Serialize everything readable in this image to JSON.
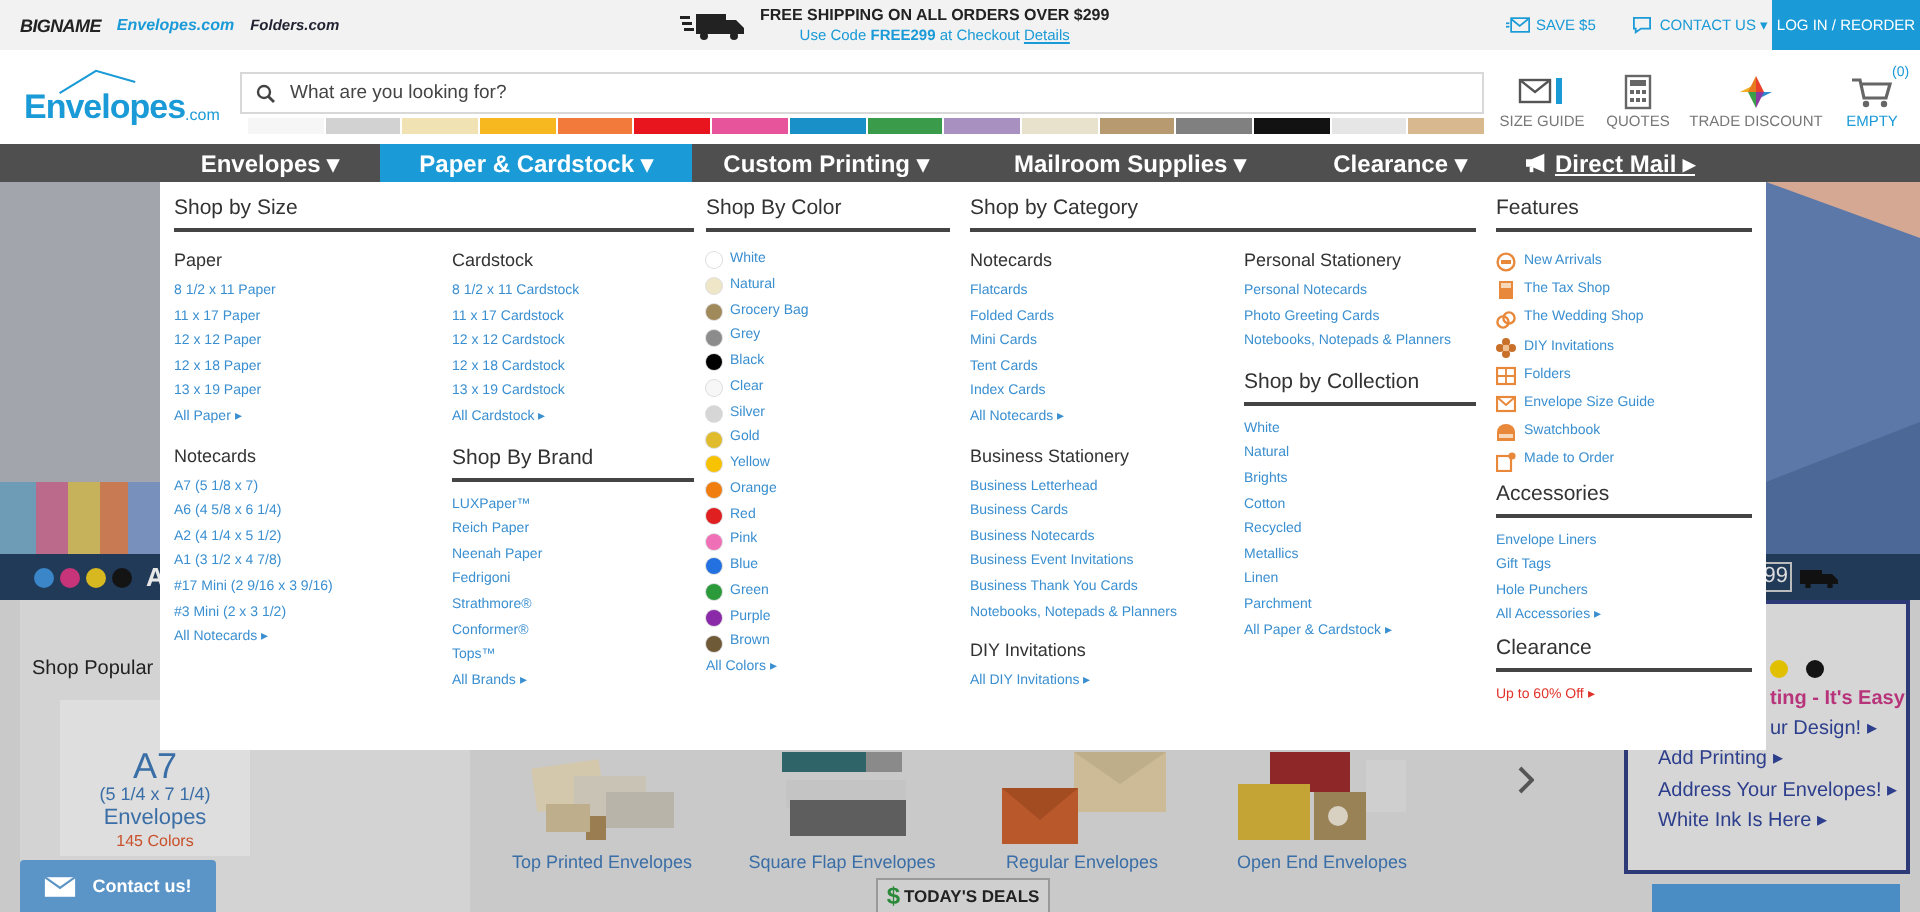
{
  "top_bar": {
    "logos": [
      {
        "text": "BIGNAME",
        "kind": "bigname"
      },
      {
        "text": "Envelopes.com",
        "kind": "envelopes"
      },
      {
        "text": "Folders.com",
        "kind": "folders"
      }
    ],
    "shipping": "FREE SHIPPING ON ALL ORDERS OVER $299",
    "code_line": "Use Code **FREE299** at Checkout",
    "details_link": "Details",
    "save": "SAVE $5",
    "contact": "CONTACT US ▾",
    "login": "LOG IN / REORDER"
  },
  "header": {
    "logo": {
      "name": "Envelopes",
      "suffix": ".com"
    },
    "search_placeholder": "What are you looking for?",
    "swatches": [
      {
        "color": "#f6f6f6"
      },
      {
        "color": "#d2d2d2"
      },
      {
        "color": "#f1e2b4"
      },
      {
        "color": "#f6b81e"
      },
      {
        "color": "#f27a3a"
      },
      {
        "color": "#e8141e"
      },
      {
        "color": "#e8549c"
      },
      {
        "color": "#1a90c8"
      },
      {
        "color": "#3a9c4a"
      },
      {
        "color": "#a890c0"
      },
      {
        "color": "#e8e2cc"
      },
      {
        "color": "#b89a70"
      },
      {
        "color": "#808080"
      },
      {
        "color": "#121212"
      },
      {
        "color": "#e6e6e6"
      },
      {
        "color": "#d8b88e"
      }
    ],
    "tools": [
      {
        "kind": "size_guide",
        "label": "SIZE GUIDE"
      },
      {
        "kind": "quotes",
        "label": "QUOTES"
      },
      {
        "kind": "trade",
        "label": "TRADE DISCOUNT"
      },
      {
        "kind": "cart",
        "label": "EMPTY",
        "count": "(0)"
      }
    ]
  },
  "nav": [
    {
      "label": "Envelopes ▾",
      "selected": false,
      "kind": "menu"
    },
    {
      "label": "Paper & Cardstock ▾",
      "selected": true,
      "kind": "menu"
    },
    {
      "label": "Custom Printing ▾",
      "selected": false,
      "kind": "menu"
    },
    {
      "label": "Mailroom Supplies ▾",
      "selected": false,
      "kind": "menu"
    },
    {
      "label": "Clearance ▾",
      "selected": false,
      "kind": "menu"
    },
    {
      "label": "Direct Mail ▸",
      "selected": false,
      "kind": "promo"
    }
  ],
  "mega_menu": {
    "by_size": {
      "title": "Shop by Size",
      "columns": [
        [
          {
            "title": "Paper",
            "links": [
              "8 1/2 x 11 Paper",
              "11 x 17 Paper",
              "12 x 12 Paper",
              "12 x 18 Paper",
              "13 x 19 Paper",
              "All Paper ▸"
            ]
          },
          {
            "title": "Notecards",
            "links": [
              "A7 (5 1/8 x 7)",
              "A6 (4 5/8 x 6 1/4)",
              "A2 (4 1/4 x 5 1/2)",
              "A1 (3 1/2 x 4 7/8)",
              "#17 Mini (2 9/16 x 3 9/16)",
              "#3 Mini (2 x 3 1/2)",
              "All Notecards ▸"
            ]
          }
        ],
        [
          {
            "title": "Cardstock",
            "links": [
              "8 1/2 x 11 Cardstock",
              "11 x 17 Cardstock",
              "12 x 12 Cardstock",
              "12 x 18 Cardstock",
              "13 x 19 Cardstock",
              "All Cardstock ▸"
            ]
          }
        ]
      ]
    },
    "by_brand": {
      "title": "Shop By Brand",
      "links": [
        "LUXPaper™",
        "Reich Paper",
        "Neenah Paper",
        "Fedrigoni",
        "Strathmore®",
        "Conformer®",
        "Tops™",
        "All Brands ▸"
      ]
    },
    "by_color": {
      "title": "Shop By Color",
      "items": [
        {
          "label": "White",
          "color": "#ffffff"
        },
        {
          "label": "Natural",
          "color": "#efe6c8"
        },
        {
          "label": "Grocery Bag",
          "color": "#a08a5c"
        },
        {
          "label": "Grey",
          "color": "#8c8c8c"
        },
        {
          "label": "Black",
          "color": "#000000"
        },
        {
          "label": "Clear",
          "color": "#f7f7f7"
        },
        {
          "label": "Silver",
          "color": "#d6d6d6"
        },
        {
          "label": "Gold",
          "color": "#e0bc2c"
        },
        {
          "label": "Yellow",
          "color": "#f7c200"
        },
        {
          "label": "Orange",
          "color": "#ef7d10"
        },
        {
          "label": "Red",
          "color": "#e02020"
        },
        {
          "label": "Pink",
          "color": "#f070b8"
        },
        {
          "label": "Blue",
          "color": "#2370e0"
        },
        {
          "label": "Green",
          "color": "#2a9a3a"
        },
        {
          "label": "Purple",
          "color": "#8a2aa8"
        },
        {
          "label": "Brown",
          "color": "#6f5a38"
        }
      ],
      "more": "All Colors ▸"
    },
    "by_category": {
      "title": "Shop by Category",
      "columns": [
        [
          {
            "title": "Notecards",
            "links": [
              "Flatcards",
              "Folded Cards",
              "Mini Cards",
              "Tent Cards",
              "Index Cards",
              "All Notecards ▸"
            ]
          },
          {
            "title": "Business Stationery",
            "links": [
              "Business Letterhead",
              "Business Cards",
              "Business Notecards",
              "Business Event Invitations",
              "Business Thank You Cards",
              "Notebooks, Notepads & Planners"
            ]
          },
          {
            "title": "DIY Invitations",
            "links": [
              "All DIY Invitations ▸"
            ]
          }
        ],
        [
          {
            "title": "Personal Stationery",
            "links": [
              "Personal Notecards",
              "Photo Greeting Cards",
              "Notebooks, Notepads & Planners"
            ]
          }
        ]
      ]
    },
    "by_collection": {
      "title": "Shop by Collection",
      "links": [
        "White",
        "Natural",
        "Brights",
        "Cotton",
        "Recycled",
        "Metallics",
        "Linen",
        "Parchment",
        "All Paper & Cardstock ▸"
      ]
    },
    "features": {
      "title": "Features",
      "items": [
        {
          "label": "New Arrivals",
          "kind": "new"
        },
        {
          "label": "The Tax Shop",
          "kind": "tax"
        },
        {
          "label": "The Wedding Shop",
          "kind": "wedding"
        },
        {
          "label": "DIY Invitations",
          "kind": "diy"
        },
        {
          "label": "Folders",
          "kind": "folders"
        },
        {
          "label": "Envelope Size Guide",
          "kind": "size"
        },
        {
          "label": "Swatchbook",
          "kind": "swatchbook"
        },
        {
          "label": "Made to Order",
          "kind": "order"
        }
      ]
    },
    "accessories": {
      "title": "Accessories",
      "links": [
        "Envelope Liners",
        "Gift Tags",
        "Hole Punchers",
        "All Accessories ▸"
      ]
    },
    "clearance": {
      "title": "Clearance",
      "links": [
        "Up to 60% Off ▸"
      ]
    }
  },
  "banner": {
    "dots": [
      {
        "color": "#3a86c8"
      },
      {
        "color": "#c8347a"
      },
      {
        "color": "#d8b820"
      },
      {
        "color": "#141414"
      }
    ],
    "text": "A",
    "badge": "99"
  },
  "popular": {
    "title": "Shop Popular",
    "size": "A7",
    "dims": "(5 1/4 x 7 1/4)",
    "label": "Envelopes",
    "count": "145 Colors"
  },
  "products": [
    {
      "label": "Top Printed Envelopes"
    },
    {
      "label": "Square Flap Envelopes"
    },
    {
      "label": "Regular Envelopes"
    },
    {
      "label": "Open End Envelopes"
    }
  ],
  "printing": {
    "dots": [
      {
        "color": "#e0c000"
      },
      {
        "color": "#141414"
      }
    ],
    "tagline": "ting - It's Easy",
    "links": [
      "ur Design! ▸",
      "Add Printing ▸",
      "Address Your Envelopes! ▸",
      "White Ink Is Here ▸"
    ]
  },
  "contact_button": "Contact us!",
  "deals": {
    "icon": "$",
    "label": "TODAY'S DEALS"
  }
}
